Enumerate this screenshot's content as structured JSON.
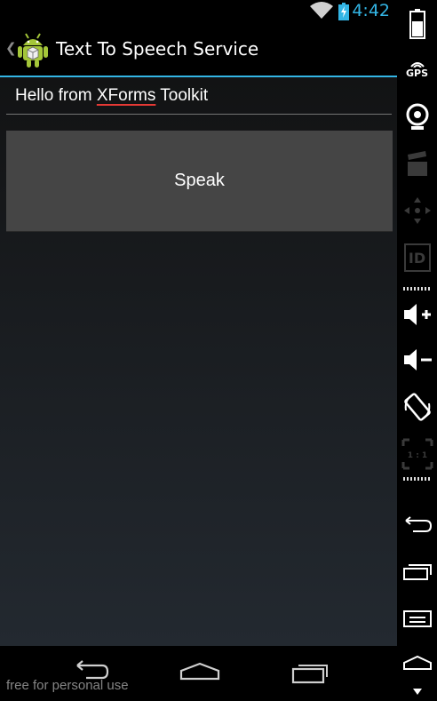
{
  "status_bar": {
    "time": "4:42",
    "accent_color": "#33b5e5"
  },
  "action_bar": {
    "title": "Text To Speech Service",
    "app_icon": "android-icon",
    "up_icon": "chevron-left-icon"
  },
  "text_input": {
    "prefix": "Hello from ",
    "misspelled_word": "XForms",
    "suffix": " Toolkit",
    "value": "Hello from XForms Toolkit"
  },
  "speak_button": {
    "label": "Speak"
  },
  "nav_bar": {
    "back_icon": "back-icon",
    "home_icon": "home-icon",
    "recents_icon": "recents-icon"
  },
  "watermark": "free for personal use",
  "side_panel": {
    "items": [
      "battery-icon",
      "gps-icon",
      "camera-icon",
      "video-icon",
      "dpad-icon",
      "id-icon",
      "volume-up-icon",
      "volume-down-icon",
      "rotate-icon",
      "scale-icon",
      "back-icon",
      "recents-icon",
      "menu-icon",
      "home-icon"
    ],
    "gps_label": "GPS",
    "id_label": "ID",
    "scale_label": "1 : 1"
  },
  "colors": {
    "button_bg": "#454545",
    "spell_underline": "#e53935"
  }
}
